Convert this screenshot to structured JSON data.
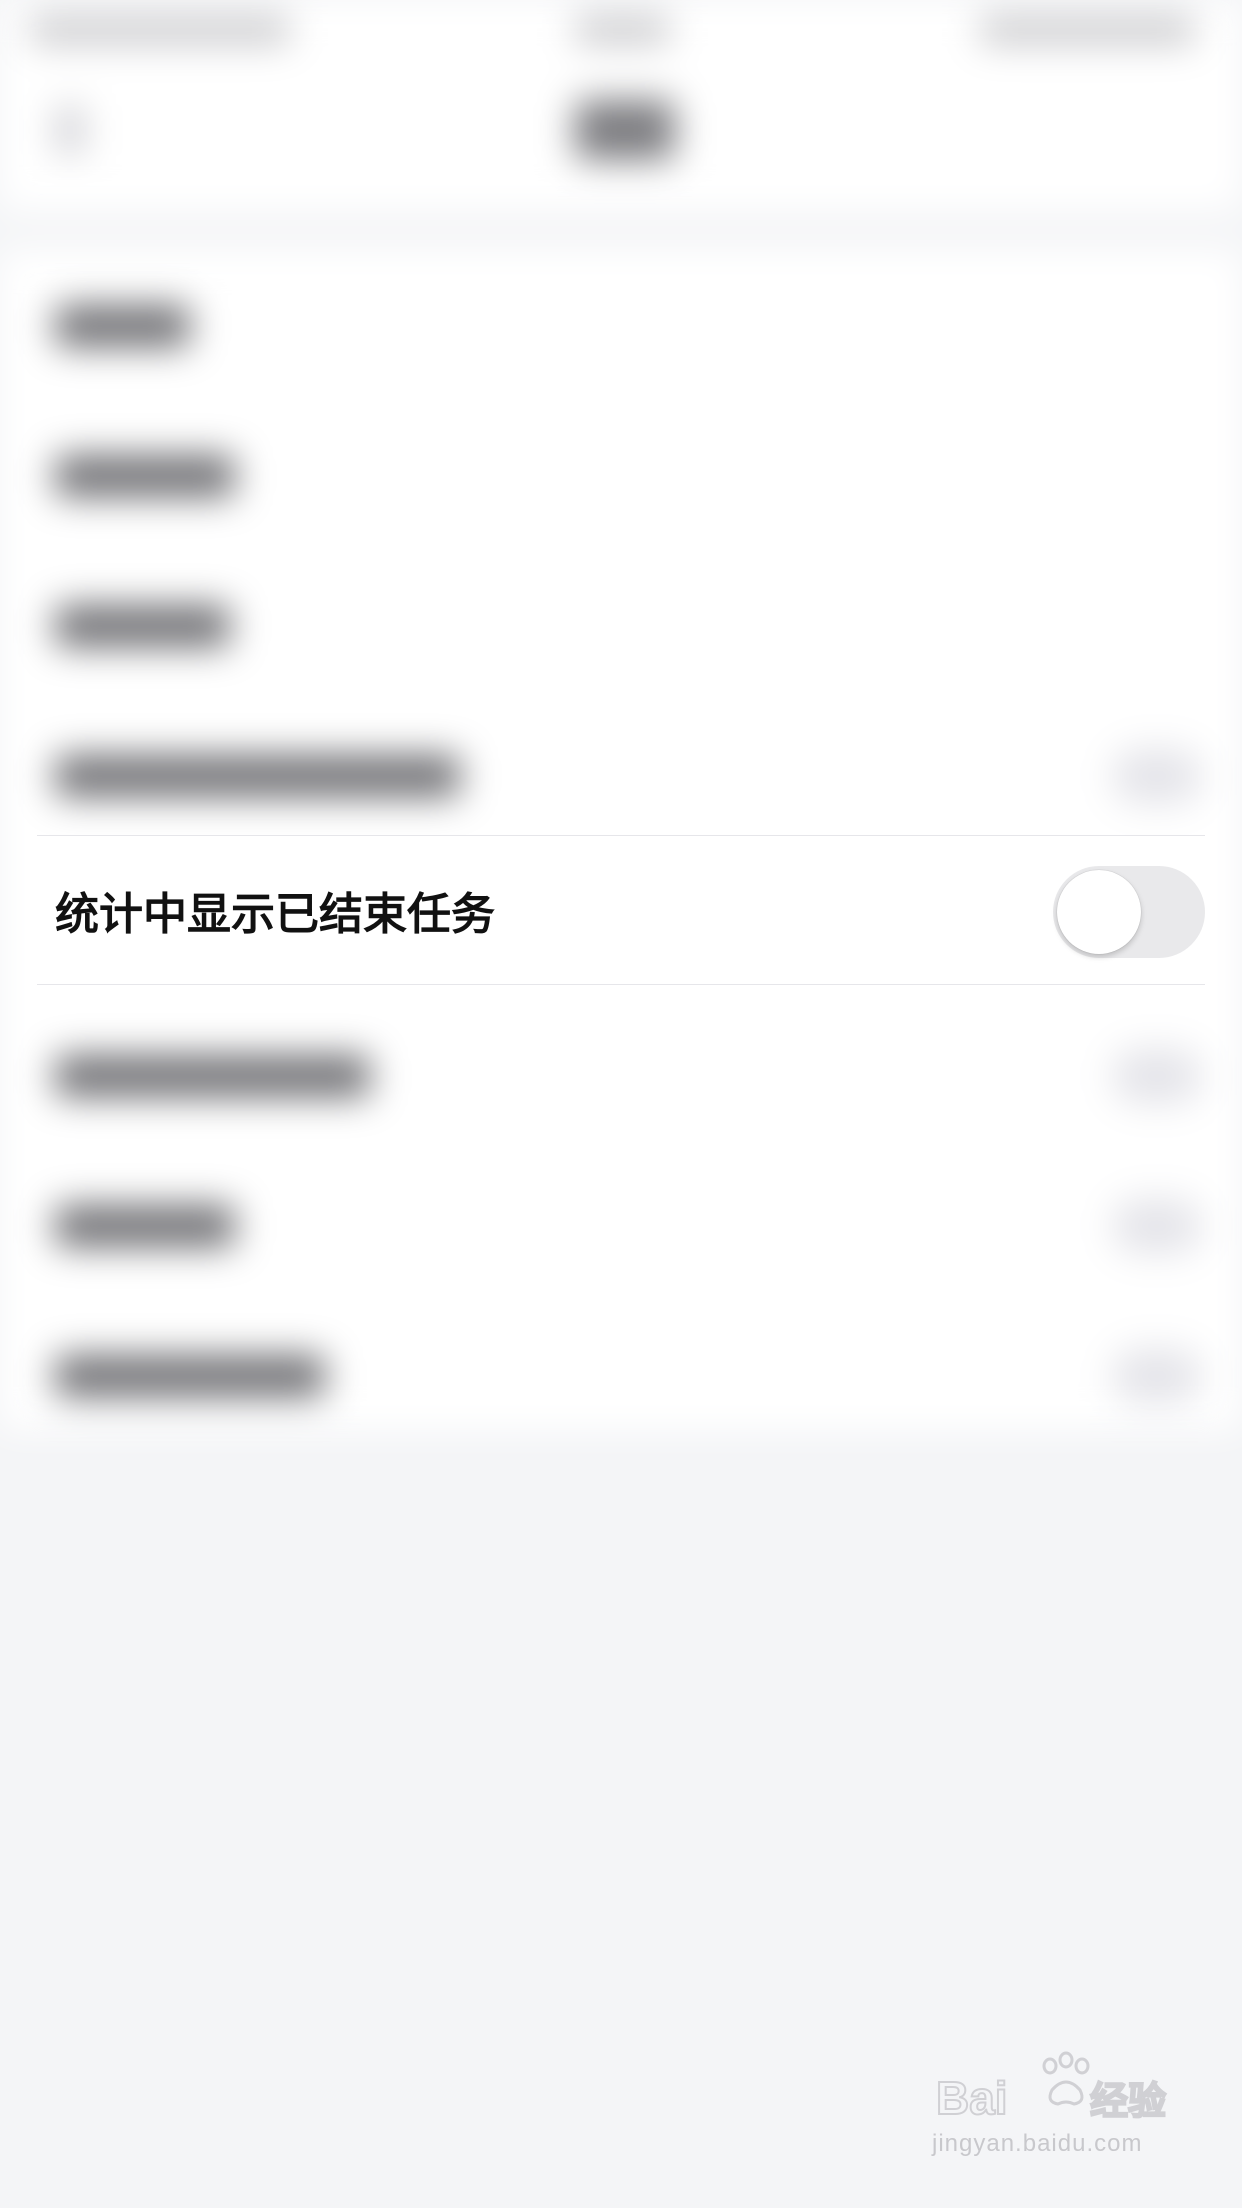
{
  "settings": {
    "show_finished_tasks_label": "统计中显示已结束任务",
    "show_finished_tasks_enabled": false
  },
  "watermark": {
    "logo_text": "Baidu经验",
    "url": "jingyan.baidu.com"
  },
  "colors": {
    "background": "#f4f5f7",
    "toggle_off_track": "#e9e9eb",
    "label_text": "#111111"
  }
}
